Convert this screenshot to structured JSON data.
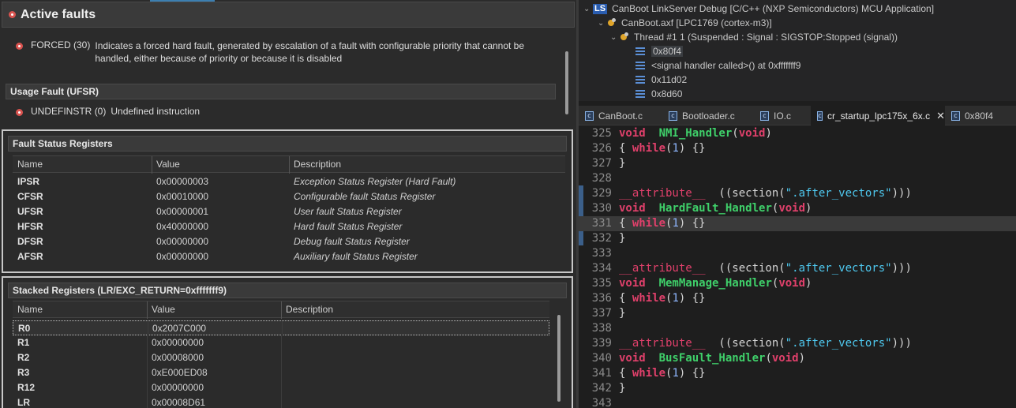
{
  "active_faults": {
    "title": "Active faults",
    "forced": {
      "name": "FORCED",
      "code": "(30)",
      "description": "Indicates a forced hard fault, generated by escalation of a fault with configurable priority that cannot be handled, either because of priority or because it is disabled"
    },
    "usage_section": "Usage Fault (UFSR)",
    "undefinstr": {
      "name": "UNDEFINSTR",
      "code": "(0)",
      "description": "Undefined instruction"
    }
  },
  "fault_status": {
    "title": "Fault Status Registers",
    "columns": [
      "Name",
      "Value",
      "Description"
    ],
    "rows": [
      {
        "name": "IPSR",
        "value": "0x00000003",
        "desc": "Exception Status Register (Hard Fault)"
      },
      {
        "name": "CFSR",
        "value": "0x00010000",
        "desc": "Configurable fault Status Register"
      },
      {
        "name": "UFSR",
        "value": "0x00000001",
        "desc": "User fault Status Register"
      },
      {
        "name": "HFSR",
        "value": "0x40000000",
        "desc": "Hard fault Status Register"
      },
      {
        "name": "DFSR",
        "value": "0x00000000",
        "desc": "Debug fault Status Register"
      },
      {
        "name": "AFSR",
        "value": "0x00000000",
        "desc": "Auxiliary fault Status Register"
      }
    ]
  },
  "stacked": {
    "title": "Stacked Registers (LR/EXC_RETURN=0xfffffff9)",
    "columns": [
      "Name",
      "Value",
      "Description"
    ],
    "rows": [
      {
        "name": "R0",
        "value": "0x2007C000",
        "desc": ""
      },
      {
        "name": "R1",
        "value": "0x00000000",
        "desc": ""
      },
      {
        "name": "R2",
        "value": "0x00008000",
        "desc": ""
      },
      {
        "name": "R3",
        "value": "0xE000ED08",
        "desc": ""
      },
      {
        "name": "R12",
        "value": "0x00000000",
        "desc": ""
      },
      {
        "name": "LR",
        "value": "0x00008D61",
        "desc": ""
      }
    ]
  },
  "debug_tree": {
    "launch": "CanBoot LinkServer Debug [C/C++ (NXP Semiconductors) MCU Application]",
    "launch_badge": "LS",
    "process": "CanBoot.axf [LPC1769 (cortex-m3)]",
    "thread": "Thread #1 1 (Suspended : Signal : SIGSTOP:Stopped (signal))",
    "frames": [
      "0x80f4",
      "<signal handler called>() at 0xfffffff9",
      "0x11d02",
      "0x8d60"
    ]
  },
  "tabs": [
    {
      "label": "CanBoot.c"
    },
    {
      "label": "Bootloader.c"
    },
    {
      "label": "IO.c"
    },
    {
      "label": "cr_startup_lpc175x_6x.c",
      "active": true,
      "close": "✕"
    },
    {
      "label": "0x80f4"
    }
  ],
  "code": [
    {
      "n": "325",
      "segs": [
        [
          "kw",
          "void"
        ],
        [
          "",
          "  "
        ],
        [
          "fn",
          "NMI_Handler"
        ],
        [
          "",
          "("
        ],
        [
          "kw",
          "void"
        ],
        [
          "",
          ")"
        ]
      ]
    },
    {
      "n": "326",
      "segs": [
        [
          "",
          "{ "
        ],
        [
          "kw",
          "while"
        ],
        [
          "",
          "("
        ],
        [
          "num",
          "1"
        ],
        [
          "",
          ") {}"
        ]
      ]
    },
    {
      "n": "327",
      "segs": [
        [
          "",
          "}"
        ]
      ]
    },
    {
      "n": "328",
      "segs": []
    },
    {
      "n": "329",
      "segs": [
        [
          "attr",
          "__attribute__"
        ],
        [
          "",
          ""
        ],
        [
          "",
          ""
        ],
        [
          "",
          "  ((section("
        ],
        [
          "str",
          "\".after_vectors\""
        ],
        [
          "",
          ")))"
        ]
      ]
    },
    {
      "n": "330",
      "segs": [
        [
          "kw",
          "void"
        ],
        [
          "",
          "  "
        ],
        [
          "fn",
          "HardFault_Handler"
        ],
        [
          "",
          "("
        ],
        [
          "kw",
          "void"
        ],
        [
          "",
          ")"
        ]
      ]
    },
    {
      "n": "331",
      "segs": [
        [
          "",
          "{ "
        ],
        [
          "kw",
          "while"
        ],
        [
          "",
          "("
        ],
        [
          "num",
          "1"
        ],
        [
          "",
          ") {}"
        ]
      ]
    },
    {
      "n": "332",
      "segs": [
        [
          "",
          "}"
        ]
      ]
    },
    {
      "n": "333",
      "segs": []
    },
    {
      "n": "334",
      "segs": [
        [
          "attr",
          "__attribute__"
        ],
        [
          "",
          "  ((section("
        ],
        [
          "str",
          "\".after_vectors\""
        ],
        [
          "",
          ")))"
        ]
      ]
    },
    {
      "n": "335",
      "segs": [
        [
          "kw",
          "void"
        ],
        [
          "",
          "  "
        ],
        [
          "fn",
          "MemManage_Handler"
        ],
        [
          "",
          "("
        ],
        [
          "kw",
          "void"
        ],
        [
          "",
          ")"
        ]
      ]
    },
    {
      "n": "336",
      "segs": [
        [
          "",
          "{ "
        ],
        [
          "kw",
          "while"
        ],
        [
          "",
          "("
        ],
        [
          "num",
          "1"
        ],
        [
          "",
          ") {}"
        ]
      ]
    },
    {
      "n": "337",
      "segs": [
        [
          "",
          "}"
        ]
      ]
    },
    {
      "n": "338",
      "segs": []
    },
    {
      "n": "339",
      "segs": [
        [
          "attr",
          "__attribute__"
        ],
        [
          "",
          "  ((section("
        ],
        [
          "str",
          "\".after_vectors\""
        ],
        [
          "",
          ")))"
        ]
      ]
    },
    {
      "n": "340",
      "segs": [
        [
          "kw",
          "void"
        ],
        [
          "",
          "  "
        ],
        [
          "fn",
          "BusFault_Handler"
        ],
        [
          "",
          "("
        ],
        [
          "kw",
          "void"
        ],
        [
          "",
          ")"
        ]
      ]
    },
    {
      "n": "341",
      "segs": [
        [
          "",
          "{ "
        ],
        [
          "kw",
          "while"
        ],
        [
          "",
          "("
        ],
        [
          "num",
          "1"
        ],
        [
          "",
          ") {}"
        ]
      ]
    },
    {
      "n": "342",
      "segs": [
        [
          "",
          "}"
        ]
      ]
    },
    {
      "n": "343",
      "segs": []
    }
  ],
  "colors": {
    "keyword": "#e0406b",
    "function": "#3fd06a",
    "string": "#4ec9f0",
    "fault_icon": "#d9534f",
    "accent": "#3c7fb1"
  }
}
